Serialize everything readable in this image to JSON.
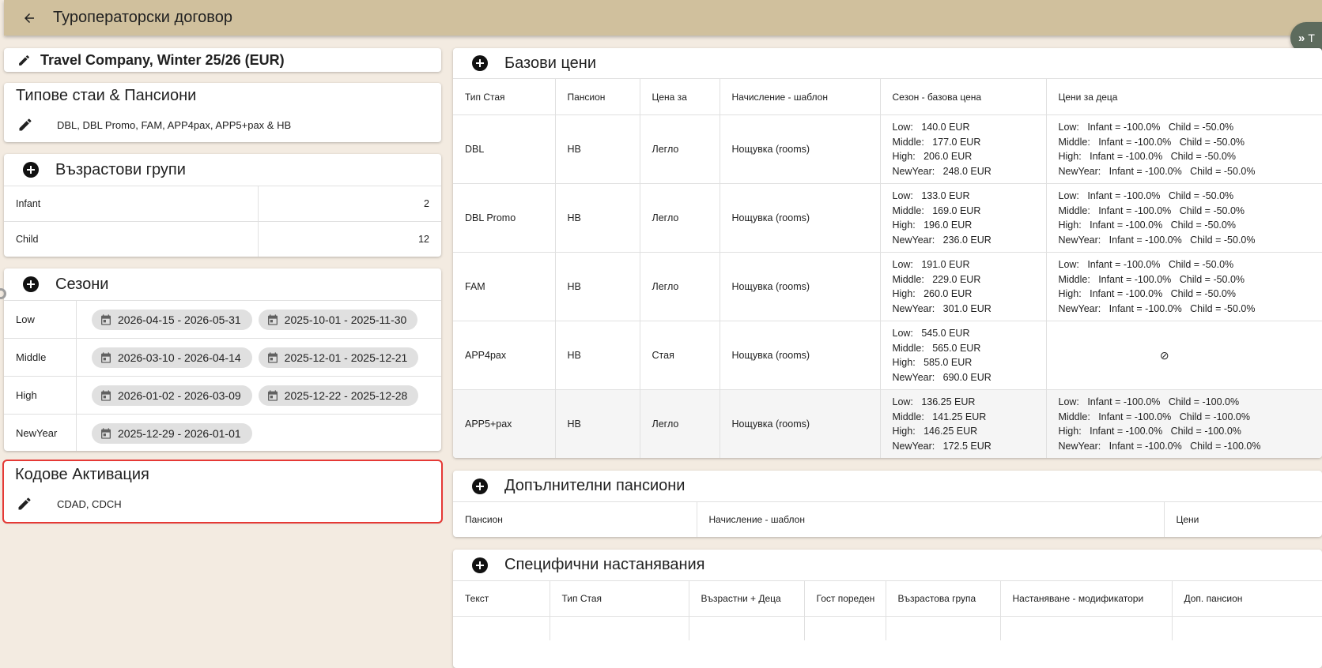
{
  "header": {
    "title": "Туроператорски договор",
    "side_label": "T"
  },
  "contract": {
    "title": "Travel Company, Winter 25/26 (EUR)"
  },
  "room_types": {
    "title": "Типове стаи & Пансиони",
    "value": "DBL, DBL Promo, FAM, APP4pax, APP5+pax & HB"
  },
  "age_groups": {
    "title": "Възрастови групи",
    "rows": [
      {
        "name": "Infant",
        "value": "2"
      },
      {
        "name": "Child",
        "value": "12"
      }
    ]
  },
  "seasons": {
    "title": "Сезони",
    "rows": [
      {
        "name": "Low",
        "ranges": [
          "2026-04-15 - 2026-05-31",
          "2025-10-01 - 2025-11-30"
        ]
      },
      {
        "name": "Middle",
        "ranges": [
          "2026-03-10 - 2026-04-14",
          "2025-12-01 - 2025-12-21"
        ]
      },
      {
        "name": "High",
        "ranges": [
          "2026-01-02 - 2026-03-09",
          "2025-12-22 - 2025-12-28"
        ]
      },
      {
        "name": "NewYear",
        "ranges": [
          "2025-12-29 - 2026-01-01"
        ]
      }
    ]
  },
  "activation_codes": {
    "title": "Кодове Активация",
    "value": "CDAD, CDCH"
  },
  "base_prices": {
    "title": "Базови цени",
    "columns": [
      "Тип Стая",
      "Пансион",
      "Цена за",
      "Начисление - шаблон",
      "Сезон - базова цена",
      "Цени за деца"
    ],
    "rows": [
      {
        "room": "DBL",
        "board": "HB",
        "price_for": "Легло",
        "template": "Нощувка (rooms)",
        "season_prices": [
          "Low:   140.0 EUR",
          "Middle:   177.0 EUR",
          "High:   206.0 EUR",
          "NewYear:   248.0 EUR"
        ],
        "child_prices": [
          "Low:   Infant = -100.0%   Child = -50.0%",
          "Middle:   Infant = -100.0%   Child = -50.0%",
          "High:   Infant = -100.0%   Child = -50.0%",
          "NewYear:   Infant = -100.0%   Child = -50.0%"
        ]
      },
      {
        "room": "DBL Promo",
        "board": "HB",
        "price_for": "Легло",
        "template": "Нощувка (rooms)",
        "season_prices": [
          "Low:   133.0 EUR",
          "Middle:   169.0 EUR",
          "High:   196.0 EUR",
          "NewYear:   236.0 EUR"
        ],
        "child_prices": [
          "Low:   Infant = -100.0%   Child = -50.0%",
          "Middle:   Infant = -100.0%   Child = -50.0%",
          "High:   Infant = -100.0%   Child = -50.0%",
          "NewYear:   Infant = -100.0%   Child = -50.0%"
        ]
      },
      {
        "room": "FAM",
        "board": "HB",
        "price_for": "Легло",
        "template": "Нощувка (rooms)",
        "season_prices": [
          "Low:   191.0 EUR",
          "Middle:   229.0 EUR",
          "High:   260.0 EUR",
          "NewYear:   301.0 EUR"
        ],
        "child_prices": [
          "Low:   Infant = -100.0%   Child = -50.0%",
          "Middle:   Infant = -100.0%   Child = -50.0%",
          "High:   Infant = -100.0%   Child = -50.0%",
          "NewYear:   Infant = -100.0%   Child = -50.0%"
        ]
      },
      {
        "room": "APP4pax",
        "board": "HB",
        "price_for": "Стая",
        "template": "Нощувка (rooms)",
        "season_prices": [
          "Low:   545.0 EUR",
          "Middle:   565.0 EUR",
          "High:   585.0 EUR",
          "NewYear:   690.0 EUR"
        ],
        "child_prices": [],
        "no_child_symbol": "⊘"
      },
      {
        "room": "APP5+pax",
        "board": "HB",
        "price_for": "Легло",
        "template": "Нощувка (rooms)",
        "season_prices": [
          "Low:   136.25 EUR",
          "Middle:   141.25 EUR",
          "High:   146.25 EUR",
          "NewYear:   172.5 EUR"
        ],
        "child_prices": [
          "Low:   Infant = -100.0%   Child = -100.0%",
          "Middle:   Infant = -100.0%   Child = -100.0%",
          "High:   Infant = -100.0%   Child = -100.0%",
          "NewYear:   Infant = -100.0%   Child = -100.0%"
        ]
      }
    ]
  },
  "extra_boards": {
    "title": "Допълнителни пансиони",
    "columns": [
      "Пансион",
      "Начисление - шаблон",
      "Цени"
    ]
  },
  "specific_accommodations": {
    "title": "Специфични настанявания",
    "columns": [
      "Текст",
      "Тип Стая",
      "Възрастни + Деца",
      "Гост пореден",
      "Възрастова група",
      "Настаняване - модификатори",
      "Доп. пансион"
    ]
  },
  "colors": {
    "topbar": "#d0c09d",
    "background": "#f3ebe1",
    "highlight": "#e53935"
  }
}
